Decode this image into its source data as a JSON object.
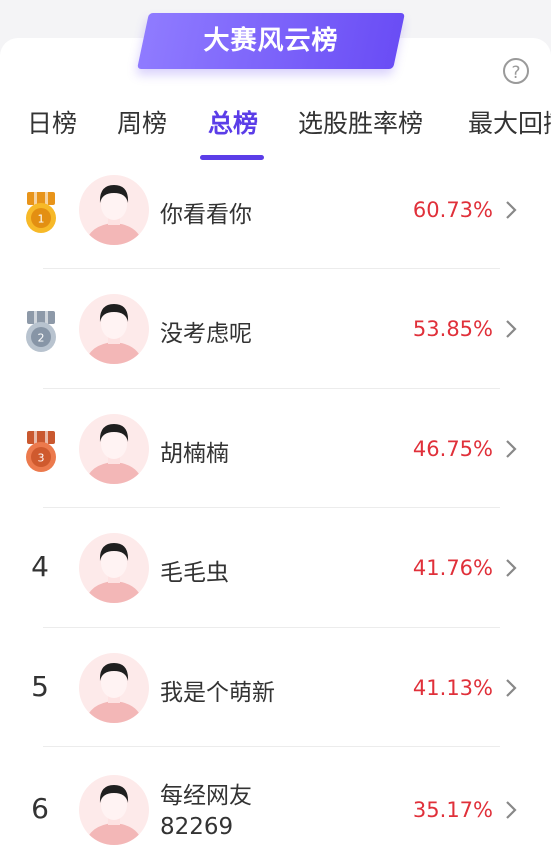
{
  "header": {
    "title": "大赛风云榜",
    "help_label": "?"
  },
  "tabs": [
    {
      "label": "日榜",
      "active": false
    },
    {
      "label": "周榜",
      "active": false
    },
    {
      "label": "总榜",
      "active": true
    },
    {
      "label": "选股胜率榜",
      "active": false
    },
    {
      "label": "最大回撤",
      "active": false
    }
  ],
  "ranking": [
    {
      "rank": "1",
      "medal": "gold",
      "name": "你看看你",
      "rate": "60.73%"
    },
    {
      "rank": "2",
      "medal": "silver",
      "name": "没考虑呢",
      "rate": "53.85%"
    },
    {
      "rank": "3",
      "medal": "bronze",
      "name": "胡楠楠",
      "rate": "46.75%"
    },
    {
      "rank": "4",
      "medal": "",
      "name": "毛毛虫",
      "rate": "41.76%"
    },
    {
      "rank": "5",
      "medal": "",
      "name": "我是个萌新",
      "rate": "41.13%"
    },
    {
      "rank": "6",
      "medal": "",
      "name_line1": "每经网友",
      "name_line2": "82269",
      "rate": "35.17%"
    }
  ],
  "colors": {
    "accent": "#5b3de8",
    "rate": "#e0303a",
    "gold": "#f0a11a",
    "silver": "#9aa7b5",
    "bronze": "#d9673d"
  }
}
